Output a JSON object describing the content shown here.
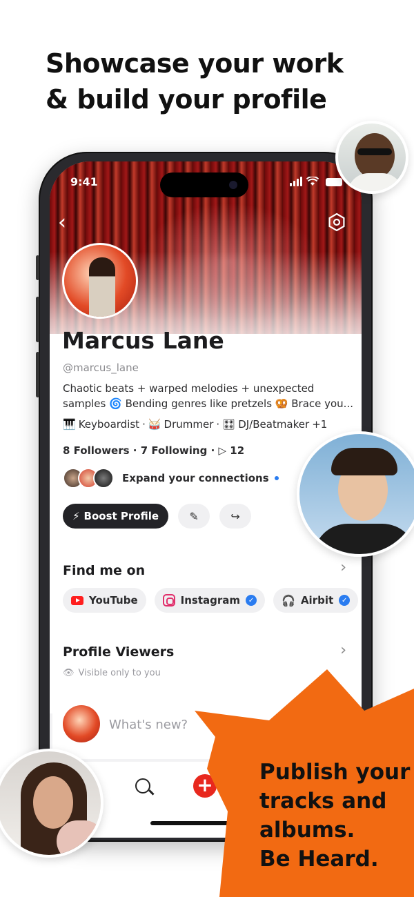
{
  "headline": {
    "line1": "Showcase your work",
    "line2": "& build your profile"
  },
  "status": {
    "time": "9:41"
  },
  "profile": {
    "name": "Marcus Lane",
    "handle": "@marcus_lane",
    "bio_line1": "Chaotic beats + warped melodies + unexpected",
    "bio_line2": "samples 🌀 Bending genres like pretzels 🥨 Brace you...",
    "roles": [
      "Keyboardist",
      "Drummer",
      "DJ/Beatmaker",
      "+1"
    ],
    "followers": "8 Followers",
    "following": "7 Following",
    "plays": "12",
    "connections_text": "Expand your connections",
    "boost_label": "Boost Profile"
  },
  "find_me": {
    "title": "Find me on",
    "links": [
      {
        "label": "YouTube",
        "icon": "youtube-icon",
        "verified": false
      },
      {
        "label": "Instagram",
        "icon": "instagram-icon",
        "verified": true
      },
      {
        "label": "Airbit",
        "icon": "airbit-icon",
        "verified": true
      }
    ]
  },
  "viewers": {
    "title": "Profile Viewers",
    "subtitle": "Visible only to you"
  },
  "composer": {
    "placeholder": "What's new?"
  },
  "promo": {
    "line1": "Publish your",
    "line2": "tracks and",
    "line3": "albums.",
    "line4": "Be Heard."
  },
  "colors": {
    "accent": "#F26A12",
    "plus": "#E8281E",
    "verified": "#2A7CF0",
    "dark_button": "#232327"
  }
}
